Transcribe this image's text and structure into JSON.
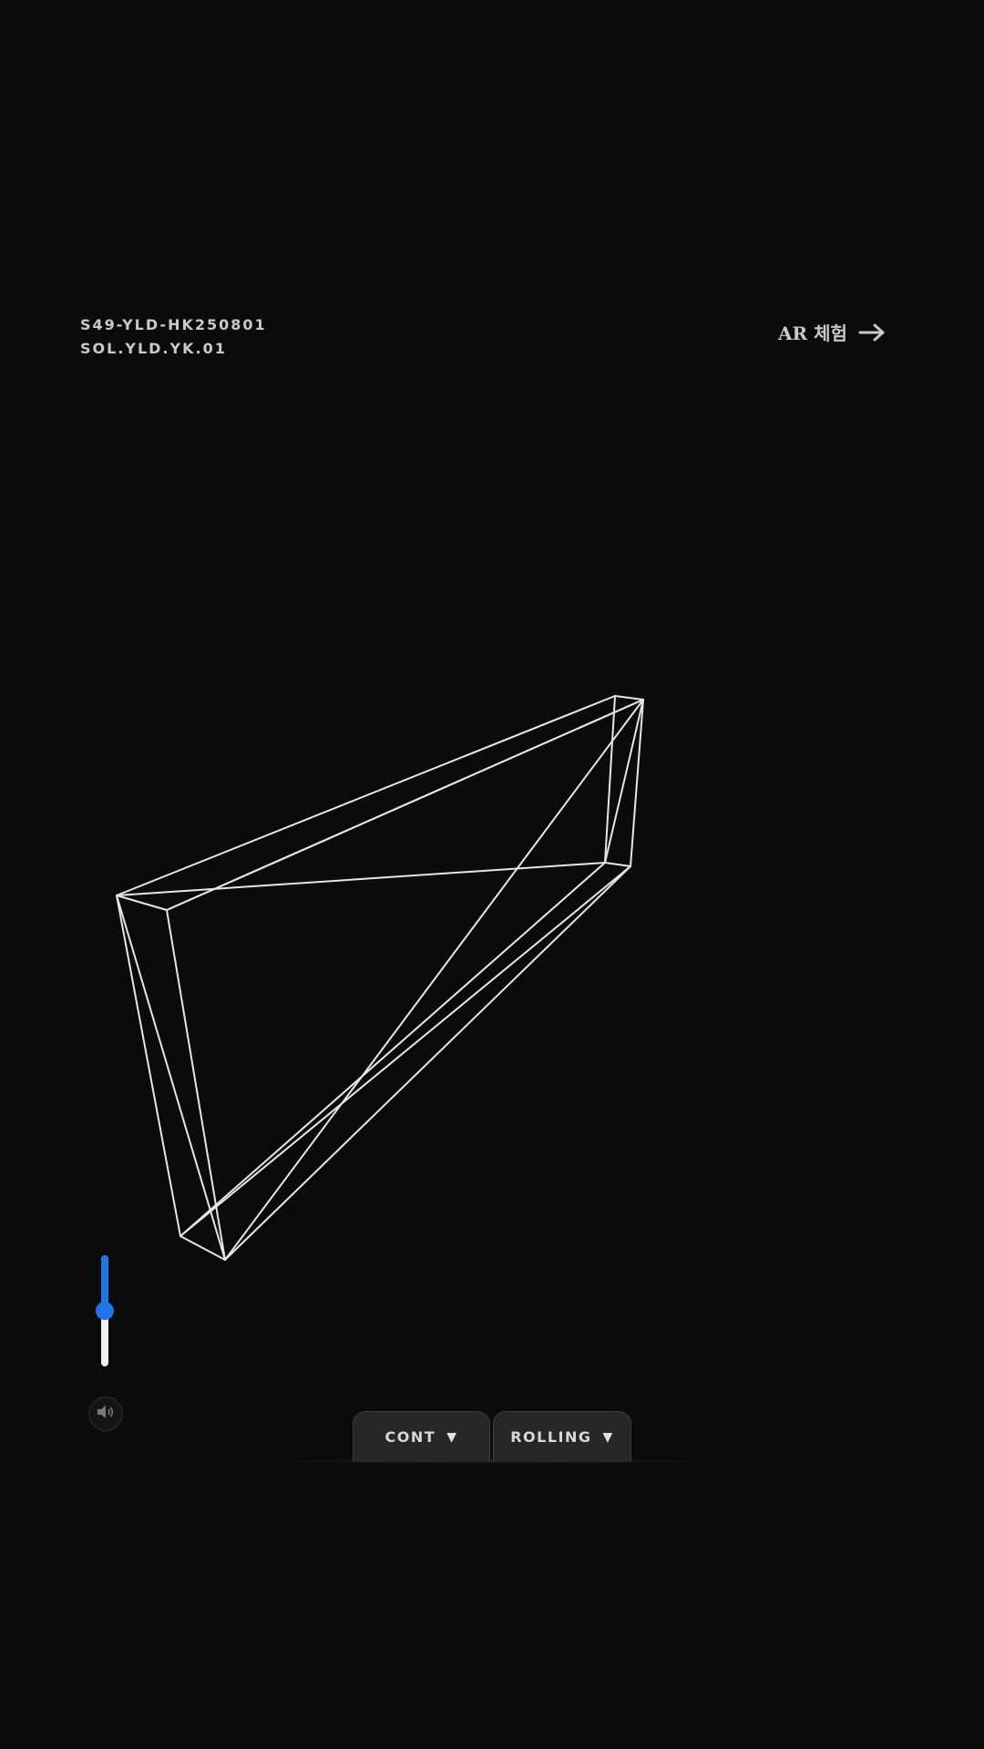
{
  "header": {
    "code_line_1": "S49-YLD-HK250801",
    "code_line_2": "SOL.YLD.YK.01",
    "ar_link_label": "AR 체험",
    "ar_link_icon": "arrow-right-icon"
  },
  "volume": {
    "level": 0.5,
    "accent_color": "#1f74e6",
    "icon": "speaker-icon"
  },
  "controls": {
    "cont_label": "CONT",
    "rolling_label": "ROLLING",
    "dropdown_icon": "caret-down-icon"
  },
  "colors": {
    "background": "#0a0b0b",
    "wireframe": "#e6e6e6",
    "accent": "#1f74e6"
  }
}
